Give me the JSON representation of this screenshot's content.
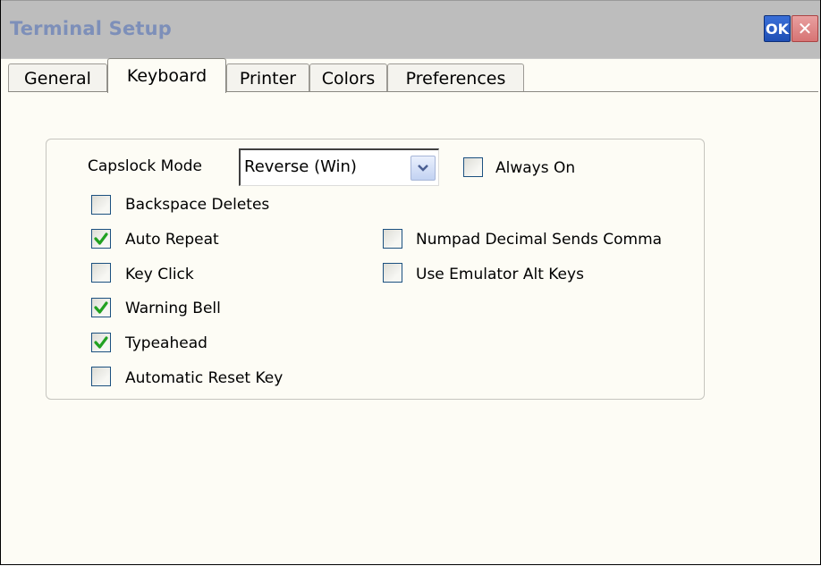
{
  "window": {
    "title": "Terminal Setup",
    "ok_label": "OK",
    "close_label": "✕"
  },
  "tabs": [
    {
      "label": "General",
      "active": false
    },
    {
      "label": "Keyboard",
      "active": true
    },
    {
      "label": "Printer",
      "active": false
    },
    {
      "label": "Colors",
      "active": false
    },
    {
      "label": "Preferences",
      "active": false
    }
  ],
  "keyboard": {
    "capslock_label": "Capslock Mode",
    "capslock_value": "Reverse (Win)",
    "always_on": {
      "label": "Always On",
      "checked": false
    },
    "left_options": [
      {
        "label": "Backspace Deletes",
        "checked": false
      },
      {
        "label": "Auto Repeat",
        "checked": true
      },
      {
        "label": "Key Click",
        "checked": false
      },
      {
        "label": "Warning Bell",
        "checked": true
      },
      {
        "label": "Typeahead",
        "checked": true
      },
      {
        "label": "Automatic Reset Key",
        "checked": false
      }
    ],
    "right_options": [
      {
        "label": "Numpad Decimal Sends Comma",
        "checked": false
      },
      {
        "label": "Use Emulator Alt Keys",
        "checked": false
      }
    ]
  },
  "colors": {
    "check": "#21a121",
    "checkbox_border": "#1c5180",
    "title_text": "#7d8fb9"
  }
}
